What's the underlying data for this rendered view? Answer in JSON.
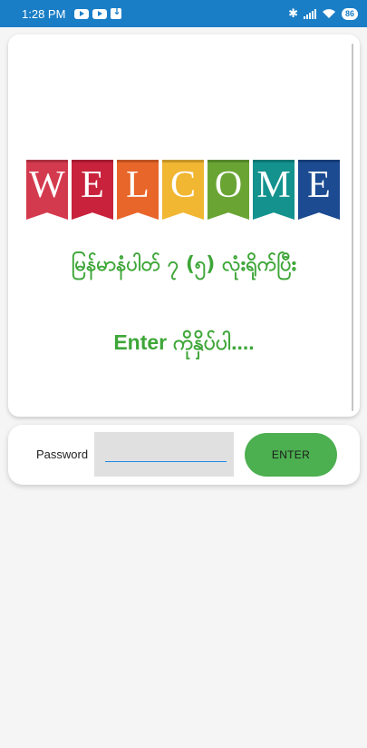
{
  "status_bar": {
    "time": "1:28 PM",
    "battery": "86",
    "icons": [
      "youtube-icon",
      "youtube-icon",
      "download-icon",
      "bluetooth-icon",
      "signal-icon",
      "wifi-icon",
      "battery-icon"
    ]
  },
  "welcome": {
    "banner_letters": [
      "W",
      "E",
      "L",
      "C",
      "O",
      "M",
      "E"
    ],
    "banner_colors": [
      "#d43a4e",
      "#c8223c",
      "#e8662a",
      "#f1b632",
      "#6aa534",
      "#13928e",
      "#1c4b91"
    ],
    "myanmar_text": "မြန်မာနံပါတ် ၇ (၅) လုံးရိုက်ပြီး",
    "enter_text": "Enter ကိုနှိပ်ပါ...."
  },
  "login": {
    "password_label": "Password",
    "password_value": "",
    "enter_button_label": "ENTER"
  },
  "colors": {
    "status_bar": "#1a7ec6",
    "accent_green": "#3ea638",
    "button_green": "#4caf50",
    "field_bg": "#e0e0e0",
    "field_underline": "#1e88e5"
  }
}
